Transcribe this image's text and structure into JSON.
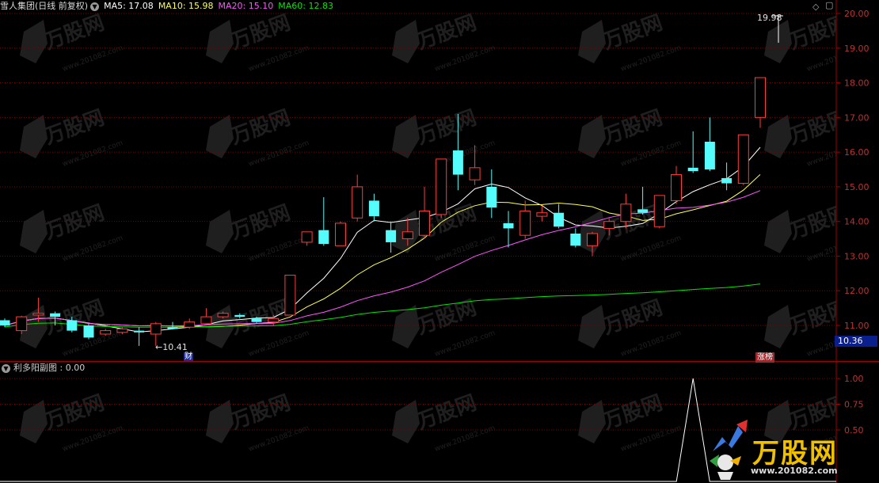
{
  "header": {
    "title": "雪人集团(日线 前复权)",
    "ma5": "MA5: 17.08",
    "ma10": "MA10: 15.98",
    "ma20": "MA20: 15.10",
    "ma60": "MA60: 12.83"
  },
  "sub_header": {
    "indicator": "利多阳副图 : 0.00"
  },
  "colors": {
    "up": "#ff3c3c",
    "down": "#54fcfc",
    "ma5": "#ffffff",
    "ma10": "#ffff54",
    "ma20": "#ff54ff",
    "ma60": "#00e600",
    "grid": "#7a0000",
    "axis": "#a00000",
    "axis_text": "#c03030"
  },
  "price_axis": {
    "labels": [
      "20.00",
      "19.00",
      "18.00",
      "17.00",
      "16.00",
      "15.00",
      "14.00",
      "13.00",
      "12.00",
      "11.00"
    ],
    "current_price": "10.36"
  },
  "sub_axis": {
    "labels": [
      "1.00",
      "0.75",
      "0.50"
    ]
  },
  "annotations": {
    "high_label": "19.98",
    "low_label": "←10.41",
    "cai": "财",
    "zhangbang": "涨榜"
  },
  "watermark": {
    "brand": "万股网",
    "url": "www.201082.com"
  },
  "chart_data": {
    "type": "candlestick",
    "ylim": [
      10.36,
      20.2
    ],
    "candles": [
      [
        11.15,
        11.0,
        11.2,
        10.95
      ],
      [
        10.85,
        11.25,
        11.28,
        10.75
      ],
      [
        11.3,
        11.35,
        11.8,
        11.1
      ],
      [
        11.35,
        11.25,
        11.4,
        11.0
      ],
      [
        11.15,
        10.85,
        11.25,
        10.8
      ],
      [
        11.0,
        10.65,
        11.05,
        10.6
      ],
      [
        10.75,
        10.85,
        10.9,
        10.7
      ],
      [
        10.8,
        10.9,
        10.95,
        10.75
      ],
      [
        10.85,
        10.8,
        10.95,
        10.41
      ],
      [
        10.75,
        11.05,
        11.1,
        10.41
      ],
      [
        10.95,
        10.9,
        11.1,
        10.9
      ],
      [
        10.95,
        11.1,
        11.2,
        10.9
      ],
      [
        11.05,
        11.25,
        11.5,
        11.05
      ],
      [
        11.25,
        11.35,
        11.4,
        11.2
      ],
      [
        11.3,
        11.25,
        11.35,
        11.2
      ],
      [
        11.2,
        11.1,
        11.25,
        11.05
      ],
      [
        11.1,
        11.2,
        11.3,
        11.0
      ],
      [
        11.3,
        12.45,
        12.45,
        11.3
      ],
      [
        13.4,
        13.7,
        13.7,
        13.3
      ],
      [
        13.75,
        13.35,
        14.7,
        13.3
      ],
      [
        13.3,
        13.95,
        14.0,
        13.3
      ],
      [
        14.1,
        15.0,
        15.35,
        14.0
      ],
      [
        14.6,
        14.15,
        14.8,
        14.0
      ],
      [
        13.75,
        13.4,
        14.0,
        13.1
      ],
      [
        13.5,
        13.7,
        14.1,
        13.3
      ],
      [
        13.6,
        14.3,
        15.0,
        13.5
      ],
      [
        14.2,
        15.8,
        15.8,
        14.1
      ],
      [
        16.05,
        15.35,
        17.1,
        14.9
      ],
      [
        15.2,
        15.55,
        16.2,
        15.05
      ],
      [
        15.0,
        14.4,
        15.5,
        14.1
      ],
      [
        13.95,
        13.8,
        14.3,
        13.25
      ],
      [
        13.6,
        14.3,
        14.6,
        13.5
      ],
      [
        14.15,
        14.25,
        14.45,
        14.0
      ],
      [
        14.25,
        13.85,
        14.5,
        13.8
      ],
      [
        13.65,
        13.3,
        13.8,
        13.25
      ],
      [
        13.3,
        13.65,
        13.7,
        13.0
      ],
      [
        13.8,
        14.0,
        14.1,
        13.6
      ],
      [
        14.0,
        14.5,
        14.8,
        13.8
      ],
      [
        14.35,
        14.25,
        15.0,
        14.2
      ],
      [
        13.85,
        14.75,
        14.75,
        13.8
      ],
      [
        14.6,
        15.35,
        15.6,
        14.5
      ],
      [
        15.55,
        15.45,
        16.6,
        15.4
      ],
      [
        16.3,
        15.5,
        17.0,
        15.45
      ],
      [
        15.25,
        15.1,
        15.7,
        14.9
      ],
      [
        15.1,
        16.5,
        16.5,
        15.05
      ],
      [
        17.0,
        18.15,
        18.15,
        16.7
      ]
    ],
    "indicator": {
      "ylim": [
        0,
        1.1
      ],
      "signal_index": 41,
      "signal_value": 1.0
    }
  }
}
